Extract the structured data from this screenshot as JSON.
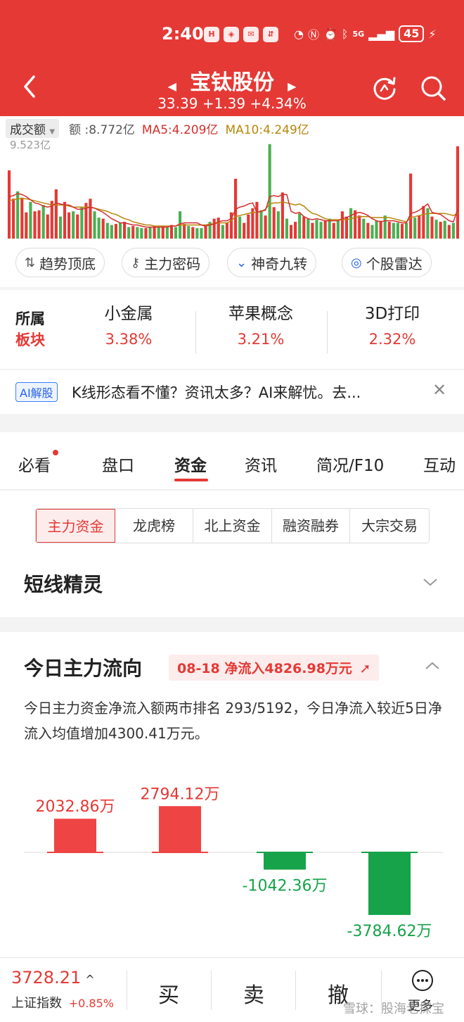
{
  "status_bar": {
    "time": "2:40",
    "apps": [
      "H",
      "◈",
      "✉",
      "⇵"
    ],
    "network": "5G",
    "battery": "45"
  },
  "header": {
    "title": "宝钛股份",
    "price": "33.39",
    "change": "+1.39",
    "change_pct": "+4.34%",
    "prev_arrow": "◀",
    "next_arrow": "▶",
    "back_icon": "back-icon",
    "refresh_icon": "refresh-icon",
    "search_icon": "search-icon"
  },
  "volume_panel": {
    "selector": "成交额",
    "amount": "额 :8.772亿",
    "ma5": "MA5:4.209亿",
    "ma10": "MA10:4.249亿",
    "max_label": "9.523亿",
    "colors": {
      "up": "#e53935",
      "down": "#4caf50",
      "ma5": "#d32f2f",
      "ma10": "#b8860b"
    }
  },
  "chart_data": {
    "type": "bar",
    "title": "成交额",
    "ylim": [
      0,
      9.523
    ],
    "values": [
      6.5,
      3.8,
      4.5,
      3.9,
      2.5,
      3.5,
      2.6,
      2.7,
      3.2,
      2.3,
      3.6,
      4.7,
      2.1,
      3.5,
      2.5,
      2.6,
      2.3,
      3.0,
      3.4,
      3.8,
      2.6,
      2.0,
      1.9,
      1.5,
      1.3,
      1.4,
      1.5,
      1.6,
      1.1,
      1.2,
      1.1,
      1.0,
      1.0,
      1.1,
      1.2,
      1.1,
      1.2,
      1.1,
      1.3,
      1.1,
      2.6,
      1.4,
      1.2,
      1.1,
      1.0,
      1.0,
      1.2,
      1.6,
      1.9,
      2.0,
      1.3,
      1.5,
      2.5,
      5.7,
      2.1,
      1.5,
      2.3,
      2.9,
      3.5,
      2.7,
      2.2,
      9.0,
      3.0,
      2.6,
      4.4,
      1.9,
      1.3,
      1.6,
      2.4,
      2.1,
      1.9,
      1.5,
      1.8,
      1.6,
      1.7,
      1.9,
      1.5,
      1.7,
      2.6,
      2.1,
      2.9,
      2.7,
      2.2,
      1.9,
      1.5,
      1.3,
      1.7,
      1.7,
      2.2,
      1.6,
      1.5,
      1.5,
      1.4,
      1.5,
      6.2,
      2.0,
      2.2,
      3.1,
      2.9,
      2.1,
      1.8,
      1.6,
      1.7,
      1.3,
      1.5,
      8.8
    ],
    "up": [
      1,
      1,
      0,
      1,
      1,
      0,
      1,
      1,
      0,
      1,
      1,
      1,
      0,
      1,
      1,
      0,
      1,
      0,
      1,
      1,
      0,
      0,
      1,
      0,
      0,
      1,
      0,
      1,
      0,
      1,
      0,
      0,
      1,
      0,
      1,
      0,
      1,
      0,
      1,
      0,
      0,
      1,
      0,
      1,
      0,
      0,
      1,
      0,
      1,
      1,
      0,
      1,
      1,
      1,
      0,
      1,
      1,
      1,
      1,
      0,
      1,
      0,
      1,
      0,
      1,
      0,
      1,
      1,
      0,
      1,
      0,
      1,
      0,
      0,
      1,
      0,
      1,
      0,
      1,
      1,
      0,
      1,
      1,
      0,
      1,
      0,
      0,
      1,
      0,
      1,
      0,
      0,
      1,
      0,
      1,
      0,
      1,
      1,
      0,
      1,
      0,
      1,
      0,
      1,
      0,
      1
    ],
    "ma5": [
      4.0,
      4.1,
      4.3,
      4.2,
      4.0,
      3.7,
      3.4,
      3.3,
      3.1,
      3.0,
      3.1,
      3.4,
      3.3,
      3.2,
      3.2,
      3.0,
      2.8,
      2.8,
      2.9,
      3.0,
      2.9,
      2.7,
      2.5,
      2.2,
      1.9,
      1.7,
      1.5,
      1.5,
      1.4,
      1.3,
      1.3,
      1.2,
      1.1,
      1.1,
      1.1,
      1.1,
      1.1,
      1.1,
      1.2,
      1.2,
      1.4,
      1.5,
      1.5,
      1.5,
      1.5,
      1.3,
      1.2,
      1.3,
      1.4,
      1.6,
      1.7,
      1.7,
      1.9,
      2.8,
      3.0,
      3.1,
      3.3,
      3.4,
      2.5,
      2.6,
      2.7,
      4.0,
      4.1,
      4.0,
      4.2,
      4.2,
      2.6,
      2.4,
      2.5,
      2.1,
      1.9,
      1.8,
      1.9,
      1.8,
      1.7,
      1.7,
      1.7,
      1.7,
      1.9,
      2.0,
      2.2,
      2.4,
      2.5,
      2.4,
      2.2,
      1.9,
      1.7,
      1.6,
      1.7,
      1.7,
      1.7,
      1.6,
      1.5,
      1.5,
      2.4,
      2.5,
      2.7,
      3.0,
      3.3,
      2.5,
      2.4,
      2.3,
      2.0,
      1.7,
      1.6,
      2.8
    ],
    "ma10": [
      3.6,
      3.7,
      3.8,
      3.8,
      3.8,
      3.7,
      3.6,
      3.5,
      3.4,
      3.3,
      3.2,
      3.2,
      3.2,
      3.2,
      3.1,
      3.0,
      3.0,
      3.0,
      3.0,
      3.0,
      2.9,
      2.8,
      2.7,
      2.6,
      2.4,
      2.3,
      2.1,
      1.9,
      1.8,
      1.6,
      1.5,
      1.4,
      1.3,
      1.3,
      1.2,
      1.2,
      1.2,
      1.2,
      1.2,
      1.2,
      1.3,
      1.3,
      1.3,
      1.3,
      1.3,
      1.3,
      1.3,
      1.4,
      1.4,
      1.5,
      1.5,
      1.5,
      1.7,
      2.1,
      2.2,
      2.3,
      2.4,
      2.5,
      2.5,
      2.6,
      2.8,
      3.3,
      3.4,
      3.4,
      3.5,
      3.4,
      3.3,
      3.2,
      3.3,
      3.1,
      2.7,
      2.4,
      2.3,
      2.1,
      1.9,
      1.8,
      1.8,
      1.8,
      1.8,
      1.8,
      1.9,
      2.0,
      2.1,
      2.1,
      2.1,
      2.0,
      2.0,
      2.0,
      2.0,
      2.0,
      1.9,
      1.8,
      1.7,
      1.6,
      2.0,
      2.1,
      2.2,
      2.3,
      2.4,
      2.4,
      2.4,
      2.4,
      2.4,
      2.3,
      2.2,
      2.4
    ]
  },
  "tools": [
    {
      "label": "趋势顶底",
      "icon": "trend-icon"
    },
    {
      "label": "主力密码",
      "icon": "key-icon"
    },
    {
      "label": "神奇九转",
      "icon": "zigzag-icon"
    },
    {
      "label": "个股雷达",
      "icon": "radar-icon"
    }
  ],
  "sectors": {
    "label_line1": "所属",
    "label_line2": "板块",
    "items": [
      {
        "name": "小金属",
        "pct": "3.38%"
      },
      {
        "name": "苹果概念",
        "pct": "3.21%"
      },
      {
        "name": "3D打印",
        "pct": "2.32%"
      }
    ]
  },
  "ai": {
    "badge": "AI解股",
    "text": "K线形态看不懂？资讯太多？AI来解忧。去...",
    "close": "✕"
  },
  "tabs": [
    "必看",
    "盘口",
    "资金",
    "资讯",
    "简况/F10",
    "互动"
  ],
  "active_tab": "资金",
  "subtabs": [
    "主力资金",
    "龙虎榜",
    "北上资金",
    "融资融券",
    "大宗交易"
  ],
  "short_line": {
    "title": "短线精灵"
  },
  "flow": {
    "title": "今日主力流向",
    "badge": "08-18 净流入4826.98万元",
    "desc": "今日主力资金净流入额两市排名 293/5192，今日净流入较近5日净流入均值增加4300.41万元。",
    "colors": {
      "in": "#ef4444",
      "out": "#16a34a"
    },
    "bars": [
      {
        "label": "2032.86万",
        "value": 2032.86
      },
      {
        "label": "2794.12万",
        "value": 2794.12
      },
      {
        "label": "-1042.36万",
        "value": -1042.36
      },
      {
        "label": "-3784.62万",
        "value": -3784.62
      }
    ]
  },
  "bottom_bar": {
    "index_value": "3728.21",
    "index_caret": "^",
    "index_name": "上证指数",
    "index_change": "+0.85%",
    "buy": "买",
    "sell": "卖",
    "cancel": "撤",
    "more": "更多",
    "watermark": "雪球：股海老探宝"
  }
}
